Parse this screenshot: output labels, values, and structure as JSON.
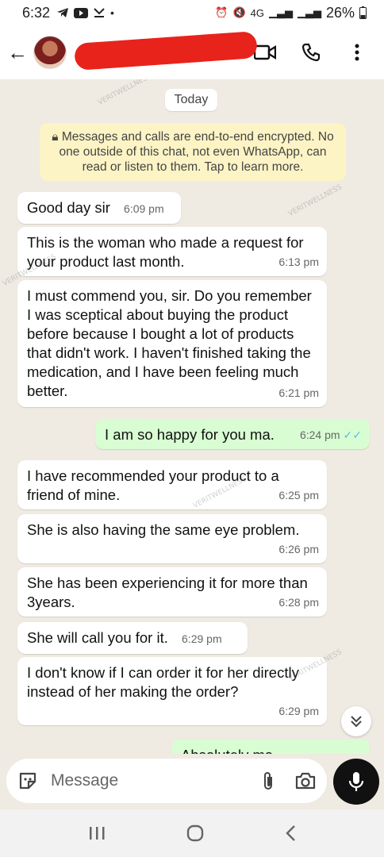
{
  "status_bar": {
    "time": "6:32",
    "battery": "26%",
    "network": "4G"
  },
  "header": {
    "back_label": "←"
  },
  "chat": {
    "date_label": "Today",
    "encryption_notice": "Messages and calls are end-to-end encrypted. No one outside of this chat, not even WhatsApp, can read or listen to them. Tap to learn more.",
    "messages": [
      {
        "dir": "in",
        "text": "Good day sir",
        "time": "6:09 pm"
      },
      {
        "dir": "in",
        "text": "This is the woman who made a request for your product last month.",
        "time": "6:13 pm"
      },
      {
        "dir": "in",
        "text": "I must commend you, sir. Do you remember I was sceptical about buying the product before because I bought a lot of products that didn't work. I haven't finished taking the medication, and I have been feeling much better.",
        "time": "6:21 pm"
      },
      {
        "dir": "out",
        "text": "I am so happy for you ma.",
        "time": "6:24 pm"
      },
      {
        "dir": "in",
        "text": "I have recommended your product to a friend of mine.",
        "time": "6:25 pm"
      },
      {
        "dir": "in",
        "text": "She is also having the same eye problem.",
        "time": "6:26 pm"
      },
      {
        "dir": "in",
        "text": "She has been experiencing it for more than 3years.",
        "time": "6:28 pm"
      },
      {
        "dir": "in",
        "text": "She will call you for it.",
        "time": "6:29 pm"
      },
      {
        "dir": "in",
        "text": "I don't know if I can order it for her directly instead of her making the order?",
        "time": "6:29 pm"
      },
      {
        "dir": "out",
        "text": "Absolutely ma",
        "time": ""
      }
    ]
  },
  "input": {
    "placeholder": "Message"
  },
  "watermark": "VERITWELLNESS",
  "colors": {
    "incoming_bubble": "#ffffff",
    "outgoing_bubble": "#d9fdd3",
    "notice_bg": "#fdf4c5",
    "read_ticks": "#53bdeb"
  }
}
